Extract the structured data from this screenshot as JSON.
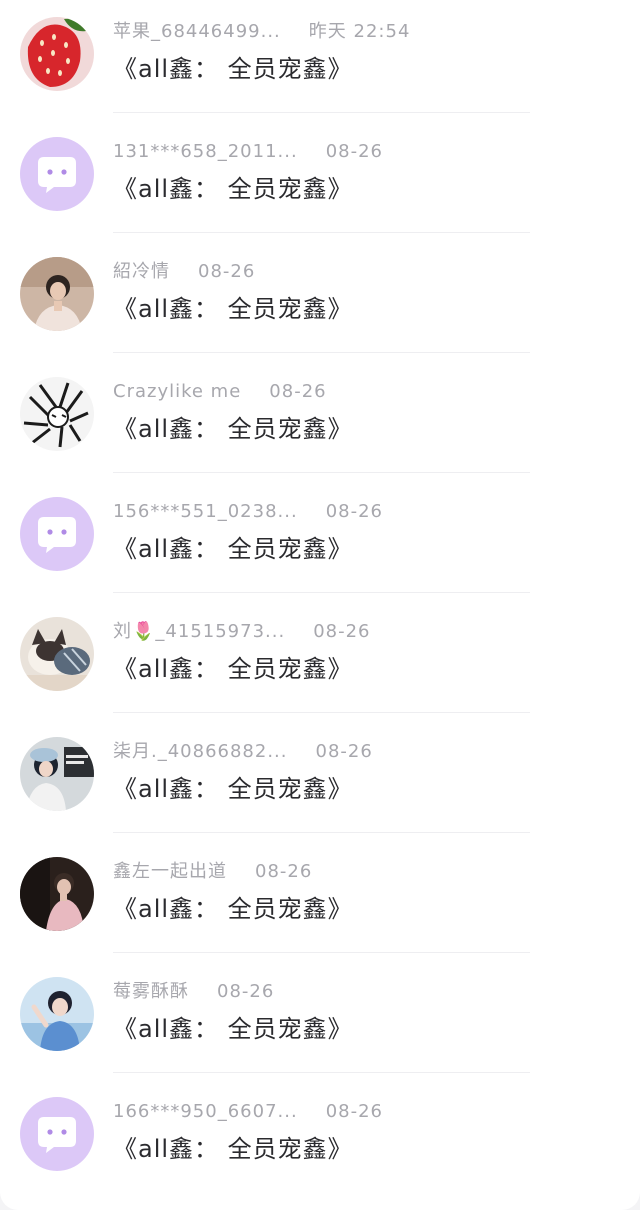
{
  "items": [
    {
      "name": "苹果_68446499...",
      "time": "昨天 22:54",
      "title": "《all鑫： 全员宠鑫》",
      "avatar": "strawberry-avatar"
    },
    {
      "name": "131***658_2011...",
      "time": "08-26",
      "title": "《all鑫： 全员宠鑫》",
      "avatar": "default-chat-avatar"
    },
    {
      "name": "紹冷情",
      "time": "08-26",
      "title": "《all鑫： 全员宠鑫》",
      "avatar": "selfie-avatar"
    },
    {
      "name": "Crazylike me",
      "time": "08-26",
      "title": "《all鑫： 全员宠鑫》",
      "avatar": "sketch-avatar"
    },
    {
      "name": "156***551_0238...",
      "time": "08-26",
      "title": "《all鑫： 全员宠鑫》",
      "avatar": "default-chat-avatar"
    },
    {
      "name": "刘🌷_41515973...",
      "time": "08-26",
      "title": "《all鑫： 全员宠鑫》",
      "avatar": "cat-avatar"
    },
    {
      "name": "柒月._40866882...",
      "time": "08-26",
      "title": "《all鑫： 全员宠鑫》",
      "avatar": "cafe-avatar"
    },
    {
      "name": "鑫左一起出道",
      "time": "08-26",
      "title": "《all鑫： 全员宠鑫》",
      "avatar": "dark-photo-avatar"
    },
    {
      "name": "莓雾酥酥",
      "time": "08-26",
      "title": "《all鑫： 全员宠鑫》",
      "avatar": "blue-photo-avatar"
    },
    {
      "name": "166***950_6607...",
      "time": "08-26",
      "title": "《all鑫： 全员宠鑫》",
      "avatar": "default-chat-avatar"
    }
  ],
  "colors": {
    "default_avatar_bg": "#dcc8f7",
    "name_text": "#a7a7ad",
    "title_text": "#2b2b2f",
    "divider": "#eeeef1"
  }
}
